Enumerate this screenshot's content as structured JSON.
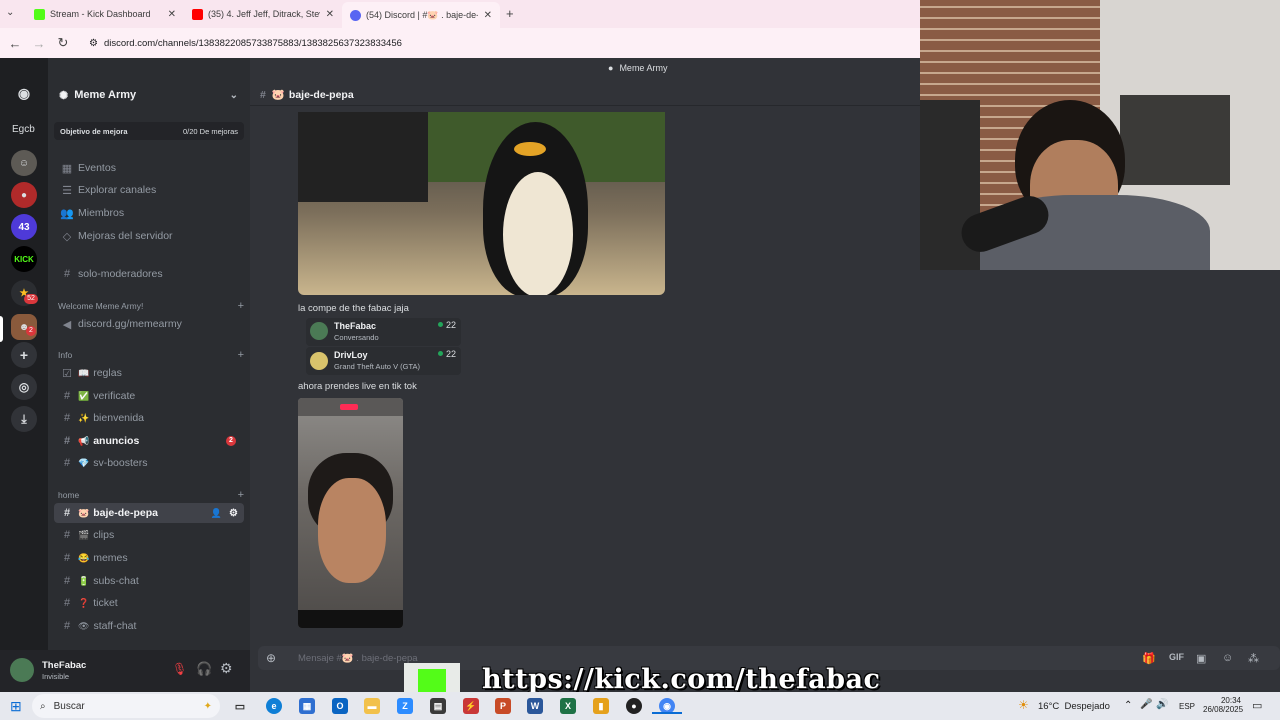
{
  "browser": {
    "tabs": [
      {
        "title": "Stream - Kick Dashboard",
        "favicon_color": "#53fc18"
      },
      {
        "title": "(35) 4. Jeff Jeff, Ditrack, Steve Sp",
        "favicon_color": "#ff0000"
      },
      {
        "title": "(54) Discord | #🐷 . baje-de-pe",
        "favicon_color": "#5865f2"
      }
    ],
    "new_tab": "+",
    "url": "discord.com/channels/1383822085733875883/1383825637323833456"
  },
  "discord": {
    "guild_label": "Egcb",
    "guild_badges": [
      "52",
      "2"
    ],
    "server_name": "Meme Army",
    "top_banner": "Meme Army",
    "boost_goal": {
      "label": "Objetivo de mejora",
      "progress": "0/20 De mejoras"
    },
    "menu": [
      {
        "label": "Eventos",
        "icon": "calendar-icon"
      },
      {
        "label": "Explorar canales",
        "icon": "channels-icon"
      },
      {
        "label": "Miembros",
        "icon": "members-icon"
      },
      {
        "label": "Mejoras del servidor",
        "icon": "boost-icon"
      }
    ],
    "channel_solo": "solo-moderadores",
    "categories": {
      "welcome": "Welcome Meme Army!",
      "info": "Info",
      "home": "home"
    },
    "welcome_channel": "discord.gg/memearmy",
    "info_channels": [
      {
        "label": "reglas",
        "emoji": "📖"
      },
      {
        "label": "verificate",
        "emoji": "✅"
      },
      {
        "label": "bienvenida",
        "emoji": "✨"
      },
      {
        "label": "anuncios",
        "emoji": "📢",
        "badge": "2"
      },
      {
        "label": "sv-boosters",
        "emoji": "💎"
      }
    ],
    "home_channels": [
      {
        "label": "baje-de-pepa",
        "emoji": "🐷"
      },
      {
        "label": "clips",
        "emoji": "🎬"
      },
      {
        "label": "memes",
        "emoji": "😂"
      },
      {
        "label": "subs-chat",
        "emoji": "🔋"
      },
      {
        "label": "ticket",
        "emoji": "❓"
      },
      {
        "label": "staff-chat",
        "emoji": "👁"
      }
    ],
    "user": {
      "name": "TheFabac",
      "status": "Invisible"
    },
    "channel_header": "baje-de-pepa",
    "messages": [
      {
        "text": "la compe de the fabac jaja"
      },
      {
        "text": "ahora prendes live en tik tok"
      }
    ],
    "activity_cards": [
      {
        "name": "TheFabac",
        "sub": "Conversando",
        "count": "22"
      },
      {
        "name": "DrivLoy",
        "sub": "Grand Theft Auto V (GTA)",
        "count": "22"
      }
    ],
    "composer_placeholder": "Mensaje #🐷 . baje-de-pepa"
  },
  "overlay": {
    "kick_url": "https://kick.com/thefabac"
  },
  "taskbar": {
    "search": "Buscar",
    "weather": "16°C  Despejado",
    "lang": "ESP",
    "time": "20:34",
    "date": "26/08/2025"
  }
}
